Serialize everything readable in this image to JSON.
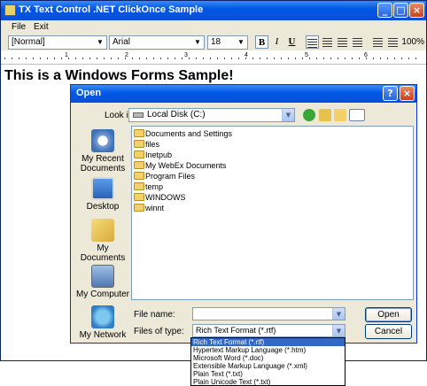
{
  "main_window": {
    "title": "TX Text Control .NET ClickOnce Sample",
    "menu": [
      "File",
      "Exit"
    ],
    "toolbar": {
      "style_value": "[Normal]",
      "font_value": "Arial",
      "size_value": "18",
      "bold": "B",
      "italic": "I",
      "underline": "U",
      "zoom": "100%"
    },
    "ruler_numbers": [
      "1",
      "2",
      "3",
      "4",
      "5",
      "6"
    ],
    "document_text": "This is a Windows Forms Sample!"
  },
  "open_dialog": {
    "title": "Open",
    "look_in_label": "Look in:",
    "look_in_label_key": "i",
    "look_in_value": "Local Disk (C:)",
    "places": [
      "My Recent Documents",
      "Desktop",
      "My Documents",
      "My Computer",
      "My Network"
    ],
    "files": [
      "Documents and Settings",
      "files",
      "Inetpub",
      "My WebEx Documents",
      "Program Files",
      "temp",
      "WINDOWS",
      "winnt"
    ],
    "file_name_label": "File name:",
    "file_name_value": "",
    "files_of_type_label": "Files of type:",
    "files_of_type_value": "Rich Text Format (*.rtf)",
    "open_button": "Open",
    "cancel_button": "Cancel",
    "type_options": [
      "Rich Text Format (*.rtf)",
      "Hypertext Markup Language (*.htm)",
      "Microsoft Word (*.doc)",
      "Extensible Markup Language (*.xml)",
      "Plain Text (*.txt)",
      "Plain Unicode Text (*.txt)"
    ],
    "selected_type_index": 0
  },
  "colors": {
    "titlebar_blue": "#0058e6",
    "dialog_face": "#ece9d8",
    "selection": "#316ac5",
    "folder_yellow": "#f2d06a"
  }
}
